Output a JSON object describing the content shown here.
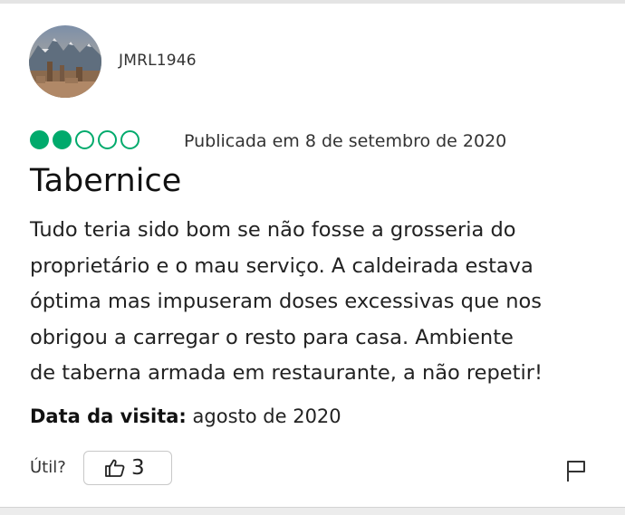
{
  "review": {
    "author": "JMRL1946",
    "rating": {
      "value": 2,
      "max": 5,
      "color": "#00aa6c"
    },
    "published": "Publicada em 8 de setembro de 2020",
    "title": "Tabernice",
    "body_lines": [
      "Tudo teria sido bom se não fosse a grosseria do",
      "proprietário e o mau serviço. A caldeirada estava",
      "óptima mas impuseram doses excessivas que nos",
      "obrigou a carregar o resto para casa. Ambiente",
      "de taberna armada em restaurante, a não repetir!"
    ],
    "visit_label": "Data da visita:",
    "visit_value": "agosto de 2020",
    "helpful_label": "Útil?",
    "helpful_count": "3",
    "icons": {
      "helpful": "thumbs-up-icon",
      "report": "flag-icon"
    }
  }
}
